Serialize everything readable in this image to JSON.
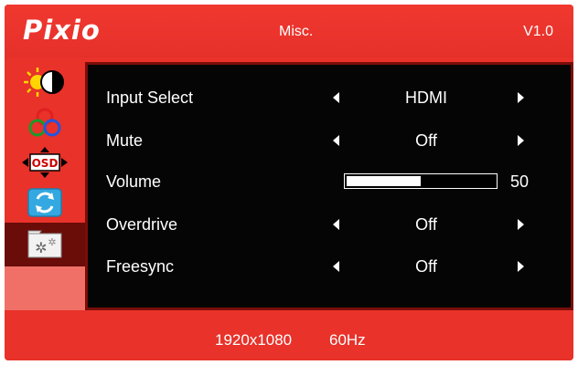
{
  "header": {
    "logo": "Pixio",
    "menu_title": "Misc.",
    "version": "V1.0"
  },
  "sidebar": {
    "tabs": [
      {
        "icon": "brightness-contrast-icon"
      },
      {
        "icon": "color-icon"
      },
      {
        "icon": "osd-settings-icon",
        "text": "OSD"
      },
      {
        "icon": "reset-icon"
      },
      {
        "icon": "misc-settings-icon",
        "active": true
      }
    ]
  },
  "settings": {
    "input_select": {
      "label": "Input Select",
      "value": "HDMI"
    },
    "mute": {
      "label": "Mute",
      "value": "Off"
    },
    "volume": {
      "label": "Volume",
      "value": "50",
      "level": 50
    },
    "overdrive": {
      "label": "Overdrive",
      "value": "Off"
    },
    "freesync": {
      "label": "Freesync",
      "value": "Off"
    }
  },
  "footer": {
    "resolution": "1920x1080",
    "refresh_rate": "60Hz"
  },
  "colors": {
    "frame": "#e8322a",
    "active_tab": "#6a0c08",
    "panel": "#050505"
  }
}
